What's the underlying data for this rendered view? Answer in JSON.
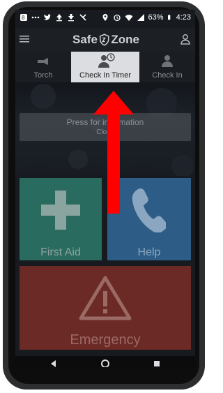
{
  "status_bar": {
    "battery": "63%",
    "time": "4:23",
    "left_icons": [
      "notification-icon",
      "dots-icon",
      "twitter-icon",
      "upload-icon",
      "download-icon",
      "notification-icon-2"
    ],
    "right_icons": [
      "location-icon",
      "alarm-icon",
      "wifi-icon",
      "signal-icon",
      "battery-icon"
    ]
  },
  "app_bar": {
    "logo_left": "Safe",
    "logo_right": "Zone"
  },
  "tabs": [
    {
      "label": "Torch",
      "icon": "torch-icon"
    },
    {
      "label": "Check In Timer",
      "icon": "person-clock-icon"
    },
    {
      "label": "Check In",
      "icon": "person-icon"
    }
  ],
  "info_box": {
    "main": "Press for information",
    "sub": "Close"
  },
  "tiles": {
    "first_aid": "First Aid",
    "help": "Help",
    "emergency": "Emergency"
  },
  "colors": {
    "first_aid": "#2a6b5f",
    "help": "#2d5d86",
    "emergency": "#6b2a25",
    "arrow": "#ff0000",
    "active_tab": "#dcdde0"
  }
}
